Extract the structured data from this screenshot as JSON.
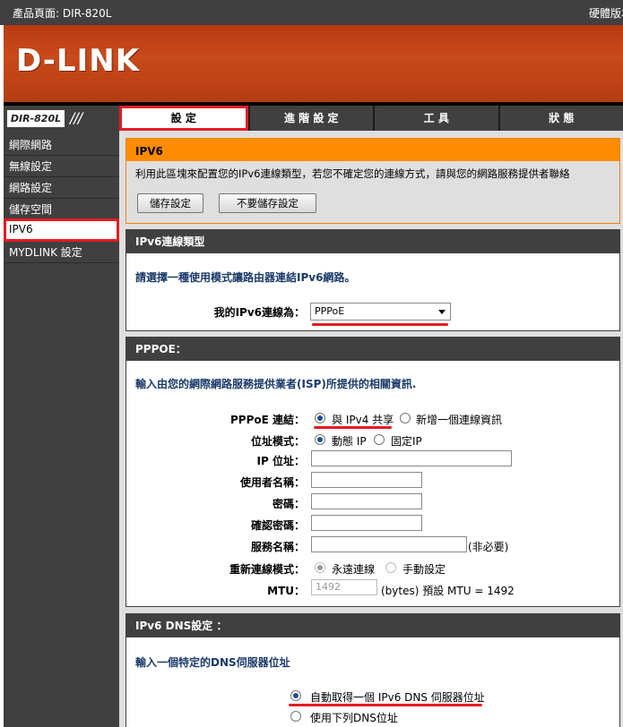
{
  "topbar": {
    "product_page": "產品頁面: DIR-820L",
    "hardware_version": "硬體版本"
  },
  "brand": {
    "logo": "D-LINK"
  },
  "model": {
    "name": "DIR-820L",
    "slashes": "///"
  },
  "nav": {
    "tabs": [
      {
        "label": "設 定"
      },
      {
        "label": "進 階 設 定"
      },
      {
        "label": "工 具"
      },
      {
        "label": "狀 態"
      }
    ]
  },
  "sidebar": {
    "items": [
      {
        "label": "網際網路"
      },
      {
        "label": "無線設定"
      },
      {
        "label": "網路設定"
      },
      {
        "label": "儲存空間"
      },
      {
        "label": "IPV6"
      },
      {
        "label": "MYDLINK 設定"
      }
    ]
  },
  "ipv6": {
    "title": "IPV6",
    "description": "利用此區塊來配置您的IPv6連線類型，若您不確定您的連線方式，請與您的網路服務提供者聯絡",
    "save_button": "儲存設定",
    "nosave_button": "不要儲存設定"
  },
  "conn_type": {
    "title": "IPv6連線類型",
    "note": "請選擇一種使用模式讓路由器連結IPv6網路。",
    "label": "我的IPv6連線為：",
    "selected": "PPPoE"
  },
  "pppoe": {
    "title": "PPPOE：",
    "note": "輸入由您的網際網路服務提供業者(ISP)所提供的相關資訊.",
    "session_label": "PPPoE 連結：",
    "session_shared": "與 IPv4 共享",
    "session_new": "新增一個連線資訊",
    "addr_mode_label": "位址模式：",
    "addr_dynamic": "動態 IP",
    "addr_static": "固定IP",
    "ip_label": "IP 位址：",
    "user_label": "使用者名稱：",
    "pwd_label": "密碼：",
    "pwd_confirm_label": "確認密碼：",
    "service_label": "服務名稱：",
    "service_optional": "(非必要)",
    "reconnect_label": "重新連線模式：",
    "reconnect_always": "永遠連線",
    "reconnect_manual": "手動設定",
    "mtu_label": "MTU：",
    "mtu_value": "1492",
    "mtu_hint": "(bytes) 預設 MTU = 1492"
  },
  "dns": {
    "title": "IPv6 DNS設定 ：",
    "note": "輸入一個特定的DNS伺服器位址",
    "auto_option": "自動取得一個 IPv6 DNS 伺服器位址",
    "manual_option": "使用下列DNS位址"
  }
}
